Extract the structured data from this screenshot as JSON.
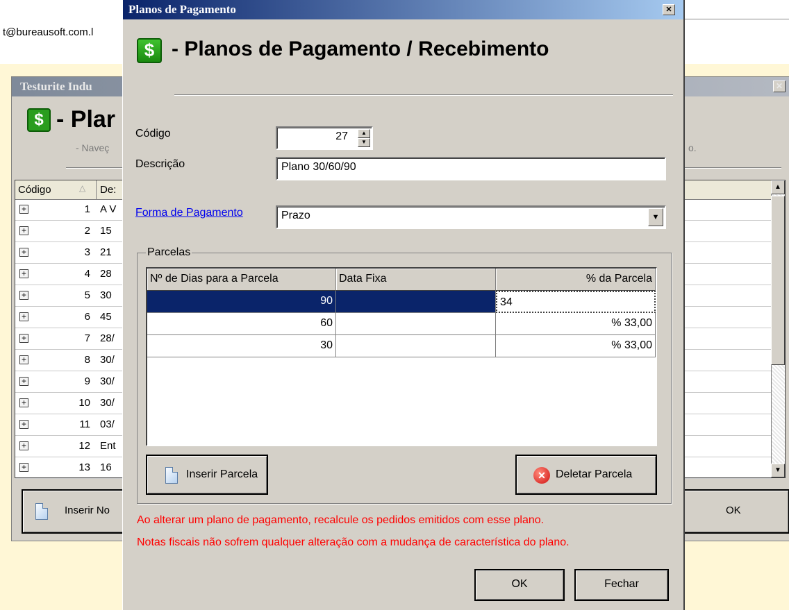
{
  "background": {
    "email_fragment": "t@bureausoft.com.l",
    "window_title": "Testurite Indu",
    "title": "- Plar",
    "subtitle": "- Naveç",
    "subtitle_right": "o.",
    "grid": {
      "header_codigo": "Código",
      "header_desc": "De:",
      "rows": [
        {
          "num": "1",
          "desc": "A V"
        },
        {
          "num": "2",
          "desc": "15"
        },
        {
          "num": "3",
          "desc": "21"
        },
        {
          "num": "4",
          "desc": "28"
        },
        {
          "num": "5",
          "desc": "30"
        },
        {
          "num": "6",
          "desc": "45"
        },
        {
          "num": "7",
          "desc": "28/"
        },
        {
          "num": "8",
          "desc": "30/"
        },
        {
          "num": "9",
          "desc": "30/"
        },
        {
          "num": "10",
          "desc": "30/"
        },
        {
          "num": "11",
          "desc": "03/"
        },
        {
          "num": "12",
          "desc": "Ent"
        },
        {
          "num": "13",
          "desc": "16"
        }
      ]
    },
    "insert_button": "Inserir No",
    "ok_button": "OK"
  },
  "dialog": {
    "window_title": "Planos de Pagamento",
    "close_glyph": "✕",
    "dollar_glyph": "$",
    "header_title": "- Planos de Pagamento / Recebimento",
    "codigo_label": "Código",
    "codigo_value": "27",
    "descricao_label": "Descrição",
    "descricao_value": "Plano 30/60/90",
    "forma_label": "Forma de Pagamento",
    "forma_value": "Prazo",
    "parcelas": {
      "label": "Parcelas",
      "columns": [
        "Nº de Dias para a Parcela",
        "Data Fixa",
        "% da Parcela"
      ],
      "rows": [
        {
          "dias": "90",
          "data": "",
          "pct": "34"
        },
        {
          "dias": "60",
          "data": "",
          "pct": "% 33,00"
        },
        {
          "dias": "30",
          "data": "",
          "pct": "% 33,00"
        }
      ]
    },
    "insert_parcela": "Inserir Parcela",
    "delete_parcela": "Deletar Parcela",
    "warning_1": "Ao alterar um plano de pagamento, recalcule os pedidos emitidos com esse plano.",
    "warning_2": "Notas fiscais não sofrem qualquer alteração com a mudança de característica do plano.",
    "ok": "OK",
    "close": "Fechar"
  }
}
